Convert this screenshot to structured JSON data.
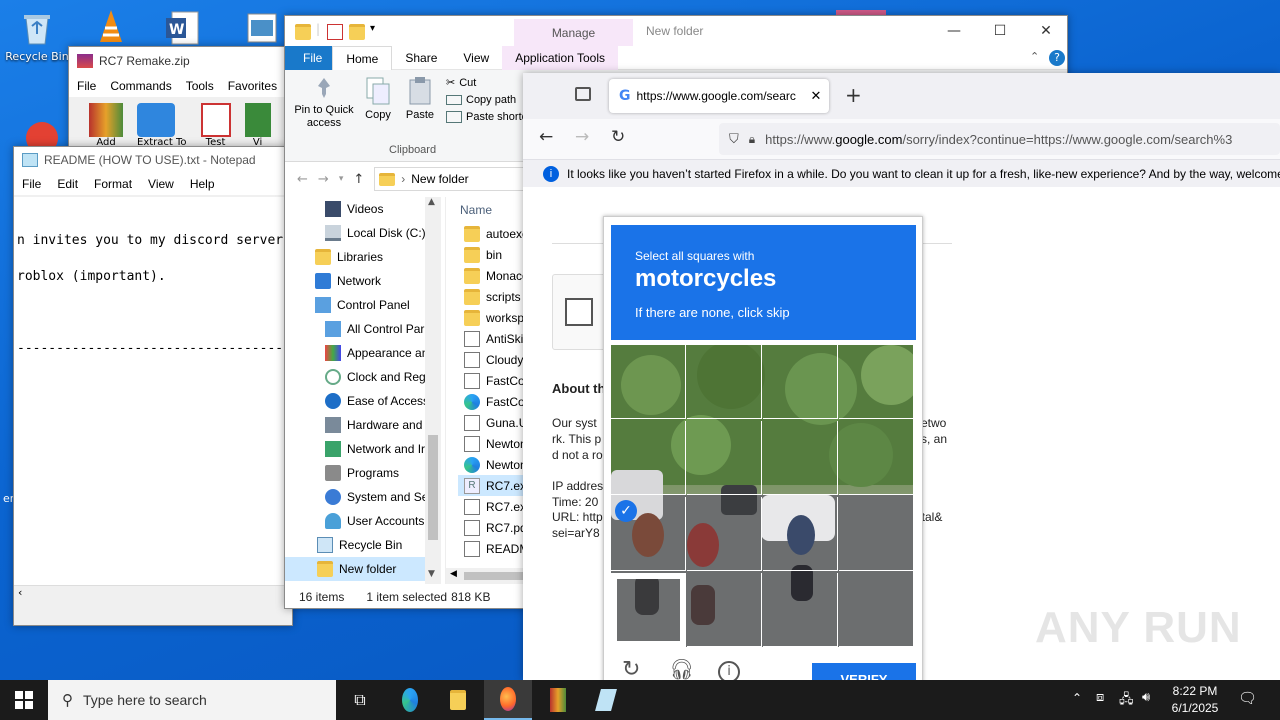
{
  "desktop": {
    "icons": [
      {
        "label": "Recycle Bin"
      }
    ],
    "edge_text": "er"
  },
  "winrar": {
    "title": "RC7 Remake.zip",
    "menu": [
      "File",
      "Commands",
      "Tools",
      "Favorites"
    ],
    "buttons": [
      "Add",
      "Extract To",
      "Test",
      "Vi"
    ]
  },
  "notepad": {
    "title": "README (HOW TO USE).txt - Notepad",
    "menu": [
      "File",
      "Edit",
      "Format",
      "View",
      "Help"
    ],
    "lines": [
      "n invites you to my discord server",
      "roblox (important).",
      "-----------------------------------"
    ]
  },
  "explorer": {
    "title": "New folder",
    "manage_label": "Manage",
    "tabs": [
      "File",
      "Home",
      "Share",
      "View",
      "Application Tools"
    ],
    "ribbon": {
      "pin_label": "Pin to Quick access",
      "copy_label": "Copy",
      "paste_label": "Paste",
      "cut_label": "Cut",
      "copy_path_label": "Copy path",
      "paste_shortcut_label": "Paste shortcut",
      "group_label": "Clipboard"
    },
    "address": "New folder",
    "tree": [
      "Videos",
      "Local Disk (C:)",
      "Libraries",
      "Network",
      "Control Panel",
      "All Control Par",
      "Appearance an",
      "Clock and Regi",
      "Ease of Access",
      "Hardware and",
      "Network and Ir",
      "Programs",
      "System and Se",
      "User Accounts",
      "Recycle Bin",
      "New folder"
    ],
    "column_name": "Name",
    "files": [
      "autoexe",
      "bin",
      "Monaco",
      "scripts",
      "workspa",
      "AntiSkid",
      "CloudyA",
      "FastColo",
      "FastColo",
      "Guna.UI",
      "Newtons",
      "Newtons",
      "RC7.exe",
      "RC7.exe",
      "RC7.pdb",
      "READMI"
    ],
    "status": {
      "items": "16 items",
      "selected": "1 item selected",
      "size": "818 KB"
    }
  },
  "firefox": {
    "tab_url": "https://www.google.com/searc",
    "url_prefix": "https://www.",
    "url_domain": "google.com",
    "url_rest": "/sorry/index?continue=https://www.google.com/search%3",
    "notice": "It looks like you haven’t started Firefox in a while. Do you want to clean it up for a fresh, like-new experience? And by the way, welcome",
    "page": {
      "about_heading": "About th",
      "para_left": [
        "Our syst",
        "rk. This p",
        "d not a ro"
      ],
      "para_right": [
        "etwo",
        "s, an"
      ],
      "ip_label": "IP addres",
      "time_label": "Time: 20",
      "url_label": "URL: http",
      "sei": "sei=arY8",
      "url_right": "otal&"
    }
  },
  "captcha": {
    "header_small": "Select all squares with",
    "header_big": "motorcycles",
    "header_sub": "If there are none, click skip",
    "verify_label": "VERIFY",
    "selected_cell": "3,0"
  },
  "taskbar": {
    "search_placeholder": "Type here to search",
    "time": "8:22 PM",
    "date": "6/1/2025"
  },
  "watermark": "ANY RUN",
  "colors": {
    "captcha_blue": "#1a73e8",
    "taskbar": "#1b1b1b",
    "accent": "#0067c0"
  }
}
